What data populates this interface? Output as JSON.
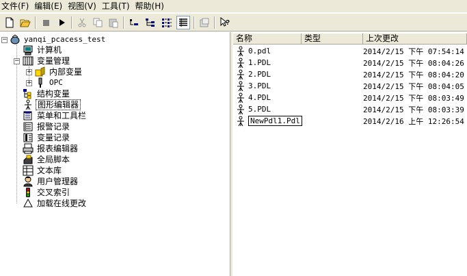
{
  "menubar": {
    "items": [
      "文件(F)",
      "编辑(E)",
      "视图(V)",
      "工具(T)",
      "帮助(H)"
    ]
  },
  "toolbar": {
    "buttons": [
      "new-icon",
      "open-icon",
      "stop-icon",
      "run-icon",
      "cut-icon",
      "copy-icon",
      "paste-icon",
      "small-icons-icon",
      "tree-view-icon",
      "list-view-icon",
      "details-view-icon",
      "properties-icon",
      "help-icon"
    ]
  },
  "tree": {
    "root": "yanqi_pcacess_test",
    "items": {
      "computer": "计算机",
      "tag_management": "变量管理",
      "internal_tags": "内部变量",
      "opc": "OPC",
      "struct_tags": "结构变量",
      "graphics_editor": "图形编辑器",
      "menus_toolbars": "菜单和工具栏",
      "alarm_logging": "报警记录",
      "tag_logging": "变量记录",
      "report_editor": "报表编辑器",
      "global_script": "全局脚本",
      "text_library": "文本库",
      "user_administrator": "用户管理器",
      "cross_reference": "交叉索引",
      "load_online_changes": "加载在线更改"
    }
  },
  "list": {
    "columns": {
      "name": "名称",
      "type": "类型",
      "modified": "上次更改"
    },
    "rows": [
      {
        "name": "0.pdl",
        "type": "",
        "modified": "2014/2/15 下午 07:54:14"
      },
      {
        "name": "1.PDL",
        "type": "",
        "modified": "2014/2/15 下午 08:04:26"
      },
      {
        "name": "2.PDL",
        "type": "",
        "modified": "2014/2/15 下午 08:04:20"
      },
      {
        "name": "3.PDL",
        "type": "",
        "modified": "2014/2/15 下午 08:04:05"
      },
      {
        "name": "4.PDL",
        "type": "",
        "modified": "2014/2/15 下午 08:03:49"
      },
      {
        "name": "5.PDL",
        "type": "",
        "modified": "2014/2/15 下午 08:03:39"
      },
      {
        "name": "NewPdl1.Pdl",
        "type": "",
        "modified": "2014/2/16 上午 12:26:54"
      }
    ]
  }
}
